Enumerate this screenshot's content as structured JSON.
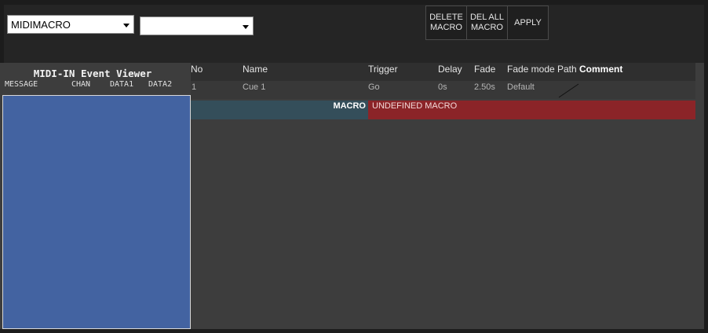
{
  "toolbar": {
    "selector_primary": "MIDIMACRO",
    "selector_secondary": "",
    "buttons": {
      "delete_macro": "DELETE\nMACRO",
      "delete_all_macro": "DEL ALL\nMACRO",
      "apply": "APPLY"
    }
  },
  "viewer": {
    "title": "MIDI-IN Event Viewer",
    "columns": [
      "MESSAGE",
      "CHAN",
      "DATA1",
      "DATA2"
    ]
  },
  "cue_table": {
    "headers": {
      "no": "No",
      "name": "Name",
      "trigger": "Trigger",
      "delay": "Delay",
      "fade": "Fade",
      "fade_mode": "Fade mode",
      "path": "Path",
      "comment": "Comment"
    },
    "rows": [
      {
        "no": "1",
        "name": "Cue 1",
        "trigger": "Go",
        "delay": "0s",
        "fade": "2.50s",
        "fade_mode": "Default"
      }
    ]
  },
  "macro": {
    "label": "MACRO",
    "value": "UNDEFINED MACRO"
  },
  "colors": {
    "viewer_box": "#4363a1",
    "macro_label_bg": "#344e5a",
    "macro_value_bg": "#8b2428"
  }
}
